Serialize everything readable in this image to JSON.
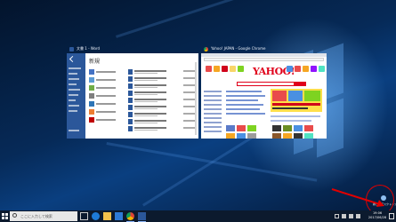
{
  "desktop": {
    "windows": [
      {
        "title": "文書 1 - Word",
        "app_icon": "word-icon",
        "accent": "#2b579a",
        "heading": "新規"
      },
      {
        "title": "Yahoo! JAPAN - Google Chrome",
        "app_icon": "chrome-icon",
        "page_logo": "YAHOO! JAPAN",
        "page_tagline": "あなたのスタートページに設定しよう"
      }
    ]
  },
  "notification": {
    "label": "新しいデスクトップ",
    "icon": "add-desktop-icon"
  },
  "taskbar": {
    "search_placeholder": "ここに入力して検索",
    "icons": [
      "start-icon",
      "task-view-icon",
      "edge-icon",
      "file-explorer-icon",
      "store-icon",
      "chrome-icon",
      "word-icon"
    ],
    "clock_time": "19:06",
    "clock_date": "2017/06/28"
  },
  "colors": {
    "accent": "#e00000",
    "taskbar": "#0c1a2e",
    "word_blue": "#2b579a",
    "yahoo_red": "#e0001b"
  }
}
